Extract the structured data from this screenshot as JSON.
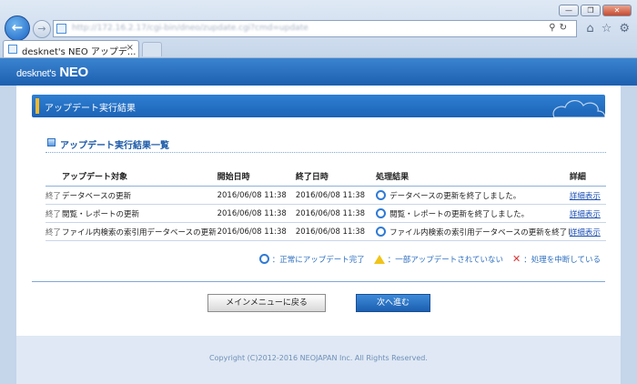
{
  "browser": {
    "address": "http://172.16.2.17/cgi-bin/dneo/zupdate.cgi?cmd=update",
    "tab_label": "desknet's NEO アップデ...",
    "tab_close": "×",
    "window_buttons": [
      "—",
      "❐",
      "✕"
    ]
  },
  "app": {
    "logo_main": "desknet's",
    "logo_neo": "NEO"
  },
  "page": {
    "title": "アップデート実行結果",
    "section_title": "アップデート実行結果一覧"
  },
  "table": {
    "headers": [
      "アップデート対象",
      "開始日時",
      "終了日時",
      "処理結果",
      "詳細"
    ],
    "rows": [
      {
        "status": "終了",
        "target": "データベースの更新",
        "start": "2016/06/08 11:38",
        "end": "2016/06/08 11:38",
        "result": "データベースの更新を終了しました。",
        "detail": "詳細表示"
      },
      {
        "status": "終了",
        "target": "閲覧・レポートの更新",
        "start": "2016/06/08 11:38",
        "end": "2016/06/08 11:38",
        "result": "閲覧・レポートの更新を終了しました。",
        "detail": "詳細表示"
      },
      {
        "status": "終了",
        "target": "ファイル内検索の索引用データベースの更新",
        "start": "2016/06/08 11:38",
        "end": "2016/06/08 11:38",
        "result": "ファイル内検索の索引用データベースの更新を終了しました。",
        "detail": "詳細表示"
      }
    ]
  },
  "legend": {
    "ok": "：正常にアップデート完了",
    "partial": "：一部アップデートされていない",
    "aborted": "：処理を中断している"
  },
  "buttons": {
    "main_menu": "メインメニューに戻る",
    "next": "次へ進む"
  },
  "footer": {
    "copyright": "Copyright (C)2012-2016 NEOJAPAN Inc. All Rights Reserved."
  },
  "colors": {
    "header_blue": "#1d5fb0",
    "accent_yellow": "#f3b92c",
    "ok_circle": "#2f7ad6",
    "abort_red": "#d93434"
  }
}
